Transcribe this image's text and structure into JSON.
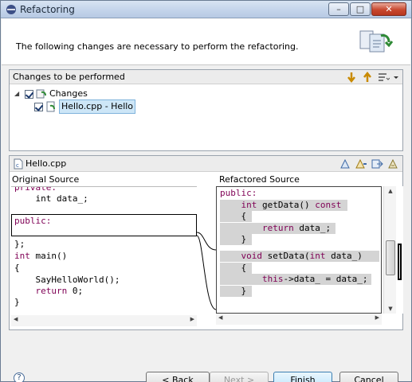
{
  "window": {
    "title": "Refactoring",
    "minimize": "–",
    "maximize": "□",
    "close": "✕"
  },
  "banner": {
    "message": "The following changes are necessary to perform the refactoring."
  },
  "changes": {
    "header": "Changes to be performed",
    "tree": [
      {
        "label": "Changes",
        "checked": true,
        "icon": "changes-icon"
      },
      {
        "label": "Hello.cpp - Hello",
        "checked": true,
        "icon": "cpp-file-change-icon",
        "selected": true
      }
    ]
  },
  "compare": {
    "file": "Hello.cpp",
    "left_title": "Original Source",
    "right_title": "Refactored Source",
    "left_lines": [
      {
        "text": "private:",
        "kw": true
      },
      {
        "text": "    int data_;"
      },
      {
        "text": ""
      },
      {
        "text": "public:",
        "kw": true
      },
      {
        "text": ""
      },
      {
        "text": "};"
      },
      {
        "text": "int main()"
      },
      {
        "text": "{"
      },
      {
        "text": "    SayHelloWorld();"
      },
      {
        "text": "    return 0;"
      },
      {
        "text": "}"
      }
    ],
    "right_lines": [
      {
        "text": "public:",
        "kw": true
      },
      {
        "text": "    int getData() const",
        "hl": true
      },
      {
        "text": "    {",
        "hl": true
      },
      {
        "text": "        return data_;",
        "hl": true
      },
      {
        "text": "    }",
        "hl": true
      },
      {
        "text": ""
      },
      {
        "text": "    void setData(int data_)",
        "hl": true
      },
      {
        "text": "    {",
        "hl": true
      },
      {
        "text": "        this->data_ = data_;",
        "hl": true
      },
      {
        "text": "    }",
        "hl": true
      }
    ]
  },
  "footer": {
    "help": "?",
    "back": "< Back",
    "next": "Next >",
    "finish": "Finish",
    "cancel": "Cancel"
  },
  "colors": {
    "keyword": "#7f0055",
    "selection": "#cde6f7",
    "highlight": "#d4d4d4"
  }
}
